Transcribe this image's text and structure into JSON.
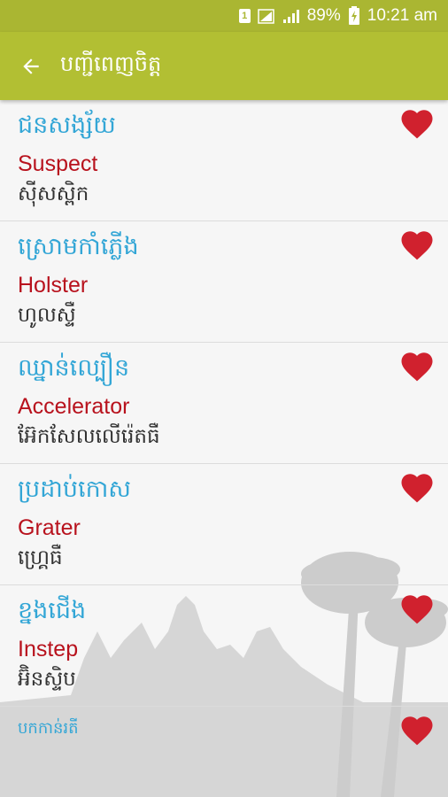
{
  "status_bar": {
    "sim_label": "1",
    "battery_percent": "89%",
    "time": "10:21 am"
  },
  "app_bar": {
    "back_icon": "arrow-left-icon",
    "title": "បញ្ជីពេញចិត្ត"
  },
  "entries": [
    {
      "khmer": "ជនសង្ស័យ",
      "english": "Suspect",
      "transliteration": "ស៊ីសស្ពិក",
      "favorite": true
    },
    {
      "khmer": "ស្រោមកាំភ្លើង",
      "english": "Holster",
      "transliteration": "ហូលស្ទឺ",
      "favorite": true
    },
    {
      "khmer": "ឈ្នាន់ល្បឿន",
      "english": "Accelerator",
      "transliteration": "អ៊ែកសែលលើរ៉េតធឺ",
      "favorite": true
    },
    {
      "khmer": "ប្រដាប់កោស",
      "english": "Grater",
      "transliteration": "ហ្គ្រេធឺ",
      "favorite": true
    },
    {
      "khmer": "ខ្នងជើង",
      "english": "Instep",
      "transliteration": "អ៊ិនស្ទិប",
      "favorite": true
    },
    {
      "khmer": "បកកាន់រតី",
      "favorite": true
    }
  ],
  "colors": {
    "status_bar": "#aab632",
    "app_bar": "#b2bf33",
    "khmer_word": "#33a6d6",
    "english_word": "#b8121d",
    "heart": "#d0212e"
  }
}
